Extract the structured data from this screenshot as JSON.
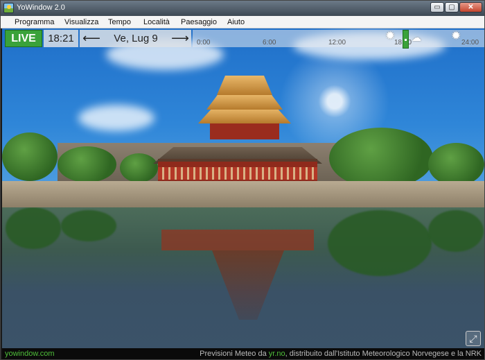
{
  "window": {
    "title": "YoWindow 2.0"
  },
  "titlebar_buttons": {
    "minimize": "▭",
    "maximize": "▢",
    "close": "✕"
  },
  "menu": [
    "Programma",
    "Visualizza",
    "Tempo",
    "Località",
    "Paesaggio",
    "Aiuto"
  ],
  "timeline": {
    "live_label": "LIVE",
    "current_time": "18:21",
    "date": "Ve, Lug 9",
    "prev_arrow": "⟵",
    "next_arrow": "⟶",
    "ticks": [
      "0:00",
      "6:00",
      "12:00",
      "18:00",
      "24:00"
    ],
    "weather_icons": [
      "sun-icon",
      "partly-cloudy-icon",
      "sun-icon"
    ]
  },
  "status": {
    "site": "yowindow.com",
    "credits_prefix": "Previsioni Meteo da ",
    "credits_source": "yr.no",
    "credits_suffix": ", distribuito dall'Istituto Meteorologico Norvegese e la NRK"
  },
  "fullscreen_icon": "⤢"
}
